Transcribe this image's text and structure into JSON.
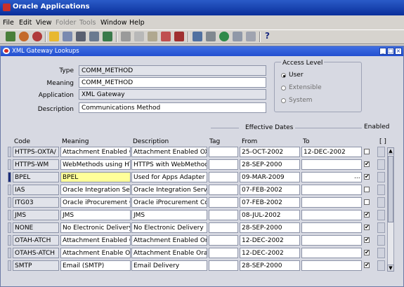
{
  "app": {
    "title": "Oracle Applications"
  },
  "menu": [
    {
      "label": "File",
      "disabled": false
    },
    {
      "label": "Edit",
      "disabled": false
    },
    {
      "label": "View",
      "disabled": false
    },
    {
      "label": "Folder",
      "disabled": true
    },
    {
      "label": "Tools",
      "disabled": true
    },
    {
      "label": "Window",
      "disabled": false
    },
    {
      "label": "Help",
      "disabled": false
    }
  ],
  "toolbar": {
    "icons": [
      "new-icon",
      "find-icon",
      "navigator-icon",
      "save-icon",
      "next-step-icon",
      "print-icon",
      "close-form-icon",
      "new-record-icon",
      "cut-icon",
      "copy-icon",
      "paste-icon",
      "clear-record-icon",
      "delete-record-icon",
      "edit-field-icon",
      "zoom-icon",
      "translations-icon",
      "attachments-icon",
      "folder-tools-icon",
      "help-icon"
    ],
    "help_symbol": "?"
  },
  "window": {
    "title": "XML Gateway Lookups",
    "min": "_",
    "max": "□",
    "close": "×"
  },
  "form": {
    "type_label": "Type",
    "type_value": "COMM_METHOD",
    "meaning_label": "Meaning",
    "meaning_value": "COMM_METHOD",
    "application_label": "Application",
    "application_value": "XML Gateway",
    "description_label": "Description",
    "description_value": "Communications Method"
  },
  "access_level": {
    "title": "Access Level",
    "options": [
      {
        "label": "User",
        "selected": true,
        "disabled": false
      },
      {
        "label": "Extensible",
        "selected": false,
        "disabled": true
      },
      {
        "label": "System",
        "selected": false,
        "disabled": true
      }
    ]
  },
  "table": {
    "group_label": "Effective Dates",
    "enabled_label": "Enabled",
    "bracket": "[ ]",
    "headers": {
      "code": "Code",
      "meaning": "Meaning",
      "description": "Description",
      "tag": "Tag",
      "from": "From",
      "to": "To"
    },
    "rows": [
      {
        "code": "HTTPS-OXTA/",
        "meaning": "Attachment Enabled C",
        "description": "Attachment Enabled OX",
        "tag": "",
        "from": "25-OCT-2002",
        "to": "12-DEC-2002",
        "enabled": false
      },
      {
        "code": "HTTPS-WM",
        "meaning": "WebMethods using HT",
        "description": "HTTPS with WebMethod",
        "tag": "",
        "from": "28-SEP-2000",
        "to": "",
        "enabled": true
      },
      {
        "code": "BPEL",
        "meaning": "BPEL",
        "description": "Used for Apps Adapter I",
        "tag": "",
        "from": "09-MAR-2009",
        "to": "",
        "enabled": true,
        "current": true
      },
      {
        "code": "IAS",
        "meaning": "Oracle Integration Sen",
        "description": "Oracle Integration Serve",
        "tag": "",
        "from": "07-FEB-2002",
        "to": "",
        "enabled": false
      },
      {
        "code": "ITG03",
        "meaning": "Oracle iProcurement C",
        "description": "Oracle iProcurement Co",
        "tag": "",
        "from": "07-FEB-2002",
        "to": "",
        "enabled": false
      },
      {
        "code": "JMS",
        "meaning": "JMS",
        "description": "JMS",
        "tag": "",
        "from": "08-JUL-2002",
        "to": "",
        "enabled": true
      },
      {
        "code": "NONE",
        "meaning": "No Electronic Delivery",
        "description": "No Electronic Delivery",
        "tag": "",
        "from": "28-SEP-2000",
        "to": "",
        "enabled": true
      },
      {
        "code": "OTAH-ATCH",
        "meaning": "Attachment Enabled C",
        "description": "Attachment Enabled  Or",
        "tag": "",
        "from": "12-DEC-2002",
        "to": "",
        "enabled": true
      },
      {
        "code": "OTAHS-ATCH",
        "meaning": "Attachment Enable Or",
        "description": "Attachment Enable Orac",
        "tag": "",
        "from": "12-DEC-2002",
        "to": "",
        "enabled": true
      },
      {
        "code": "SMTP",
        "meaning": "Email (SMTP)",
        "description": "Email Delivery",
        "tag": "",
        "from": "28-SEP-2000",
        "to": "",
        "enabled": true
      }
    ],
    "lov_button": "..."
  }
}
